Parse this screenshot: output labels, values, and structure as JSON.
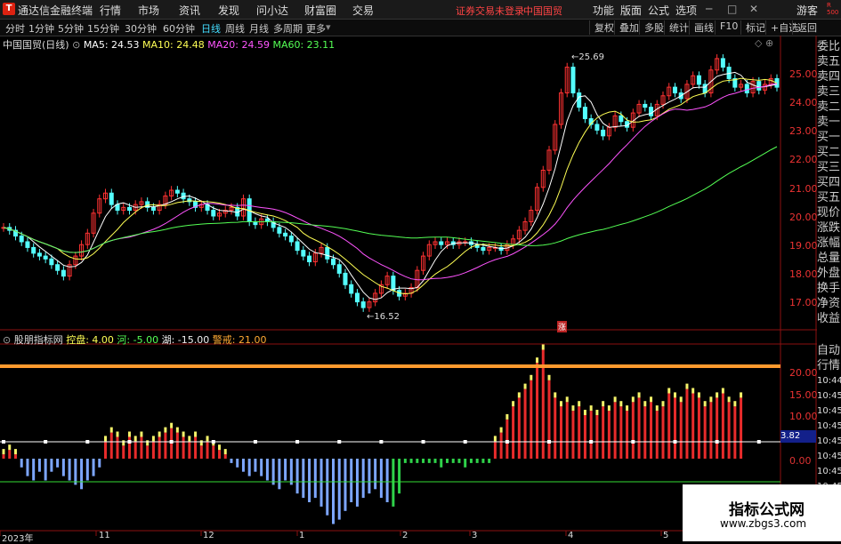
{
  "menubar": {
    "app_title": "通达信金融终端",
    "items": [
      "行情",
      "市场",
      "资讯",
      "发现",
      "问小达",
      "财富圈",
      "交易"
    ],
    "warning": "证券交易未登录",
    "stock_name_top": "中国国贸",
    "right_items": [
      "功能",
      "版面",
      "公式",
      "选项"
    ],
    "guest": "游客"
  },
  "toolbar": {
    "periods": [
      "分时",
      "1分钟",
      "5分钟",
      "15分钟",
      "30分钟",
      "60分钟",
      "日线",
      "周线",
      "月线",
      "多周期",
      "更多"
    ],
    "active": "日线",
    "right": [
      "复权",
      "叠加",
      "多股",
      "统计",
      "画线",
      "F10",
      "标记",
      "+自选",
      "返回"
    ]
  },
  "price_legend": {
    "stock": "中国国贸(日线)",
    "ma5": "MA5: 24.53",
    "ma10": "MA10: 24.48",
    "ma20": "MA20: 24.59",
    "ma60": "MA60: 23.11"
  },
  "indicator_legend": {
    "name": "股朋指标网",
    "k1": "控盘: 4.00",
    "k2": "河: -5.00",
    "k3": "湖: -15.00",
    "k4": "警戒: 21.00"
  },
  "price_axis": [
    "25.00",
    "24.00",
    "23.00",
    "22.00",
    "21.00",
    "20.00",
    "19.00",
    "18.00",
    "17.00"
  ],
  "ind_axis": [
    "20.00",
    "15.00",
    "10.00",
    "5.00",
    "0.00"
  ],
  "ind_cur": "3.82",
  "high_label": "25.69",
  "low_label": "16.52",
  "zhang_label": "涨",
  "right_panel": [
    "委比",
    "卖五",
    "卖四",
    "卖三",
    "卖二",
    "卖一",
    "买一",
    "买二",
    "买三",
    "买四",
    "买五",
    "现价",
    "涨跌",
    "涨幅",
    "总量",
    "外盘",
    "换手",
    "净资",
    "收益"
  ],
  "right_panel2": [
    "自动",
    "行情"
  ],
  "time_ticks": [
    "10:44",
    "10:45",
    "10:45",
    "10:45",
    "10:45",
    "10:45",
    "10:45",
    "10:45",
    "10:45"
  ],
  "x_labels": [
    "2023年",
    "11",
    "12",
    "1",
    "2",
    "3",
    "4",
    "5"
  ],
  "watermark": {
    "line1": "指标公式网",
    "line2": "www.zbgs3.com"
  },
  "colors": {
    "up": "#ff3232",
    "down": "#54ffff",
    "ma5": "#ffffff",
    "ma10": "#ffff54",
    "ma20": "#ff54ff",
    "ma60": "#54ff54",
    "warn_line": "#ff9a2e"
  },
  "chart_data": {
    "type": "candlestick",
    "closes": [
      19.6,
      19.5,
      19.3,
      19.1,
      18.9,
      18.7,
      18.6,
      18.5,
      18.3,
      18.1,
      17.9,
      18.3,
      18.6,
      19.0,
      19.4,
      20.1,
      20.6,
      20.8,
      20.4,
      20.2,
      20.3,
      20.2,
      20.4,
      20.5,
      20.3,
      20.2,
      20.4,
      20.7,
      20.9,
      20.8,
      20.6,
      20.5,
      20.3,
      20.4,
      20.2,
      20.0,
      20.1,
      20.2,
      20.3,
      20.0,
      20.6,
      19.8,
      19.7,
      19.9,
      19.8,
      19.6,
      19.4,
      19.3,
      19.1,
      18.8,
      18.6,
      18.4,
      18.7,
      18.9,
      18.5,
      18.3,
      18.0,
      17.6,
      17.3,
      17.0,
      16.8,
      17.0,
      17.3,
      17.6,
      17.9,
      17.4,
      17.2,
      17.3,
      17.5,
      18.1,
      18.6,
      19.0,
      19.1,
      19.0,
      19.1,
      19.0,
      19.1,
      19.1,
      19.0,
      18.9,
      18.8,
      18.9,
      18.9,
      18.8,
      19.0,
      19.2,
      19.5,
      19.8,
      20.2,
      21.0,
      21.6,
      22.3,
      23.2,
      24.3,
      25.2,
      24.3,
      23.8,
      23.4,
      23.2,
      23.0,
      22.8,
      23.1,
      23.5,
      23.3,
      23.1,
      23.6,
      23.9,
      23.8,
      23.5,
      23.9,
      24.2,
      24.5,
      24.3,
      24.1,
      24.6,
      24.9,
      24.6,
      24.3,
      25.1,
      25.5,
      25.2,
      24.8,
      24.5,
      24.6,
      24.3,
      24.7,
      24.4,
      24.6,
      24.8,
      24.5
    ],
    "ind": [
      1,
      2,
      1,
      -2,
      -4,
      -5,
      -3,
      -5,
      -3,
      -2,
      -4,
      -5,
      -6,
      -7,
      -5,
      -4,
      -2,
      4,
      6,
      5,
      3,
      5,
      4,
      5,
      3,
      4,
      5,
      6,
      7,
      6,
      5,
      4,
      5,
      3,
      4,
      3,
      2,
      1,
      -1,
      -2,
      -3,
      -4,
      -3,
      -4,
      -5,
      -6,
      -7,
      -5,
      -6,
      -8,
      -9,
      -10,
      -9,
      -11,
      -13,
      -15,
      -14,
      -12,
      -10,
      -11,
      -9,
      -8,
      -7,
      -9,
      -10,
      -11,
      -8,
      -1,
      -1,
      -1,
      -1,
      -1,
      -1,
      -2,
      -1,
      -1,
      -1,
      -2,
      -1,
      -1,
      -1,
      -1,
      4,
      6,
      9,
      12,
      14,
      16,
      18,
      22,
      25,
      18,
      14,
      12,
      13,
      11,
      12,
      10,
      11,
      10,
      12,
      11,
      13,
      12,
      11,
      13,
      14,
      12,
      13,
      11,
      12,
      15,
      14,
      13,
      16,
      15,
      14,
      12,
      13,
      14,
      15,
      13,
      12,
      14
    ],
    "ma_lines": [
      "MA5",
      "MA10",
      "MA20",
      "MA60"
    ]
  }
}
